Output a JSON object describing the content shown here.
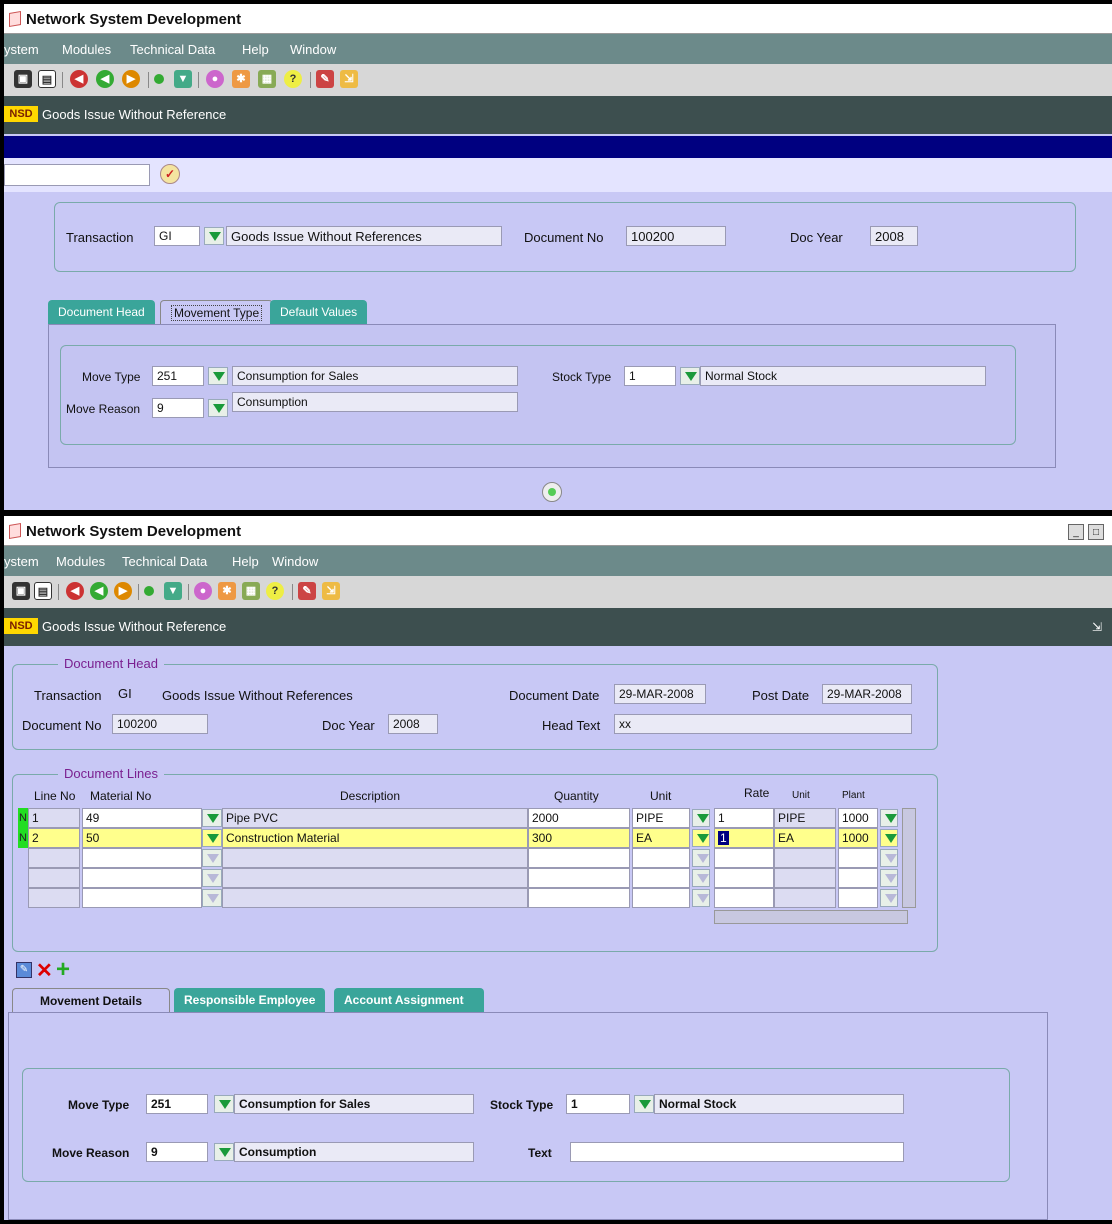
{
  "top": {
    "title": "Network System Development",
    "menu": [
      "ystem",
      "Modules",
      "Technical Data",
      "Help",
      "Window"
    ],
    "form_logo": "NSD",
    "form_title": "Goods Issue Without Reference",
    "transaction_label": "Transaction",
    "transaction_code": "GI",
    "transaction_desc": "Goods Issue Without References",
    "docno_label": "Document No",
    "docno": "100200",
    "docyear_label": "Doc Year",
    "docyear": "2008",
    "tabs": [
      "Document Head",
      "Movement Type",
      "Default Values"
    ],
    "move_type_label": "Move Type",
    "move_type": "251",
    "move_type_desc": "Consumption for Sales",
    "stock_type_label": "Stock Type",
    "stock_type": "1",
    "stock_type_desc": "Normal Stock",
    "move_reason_label": "Move Reason",
    "move_reason": "9",
    "move_reason_desc": "Consumption"
  },
  "bottom": {
    "title": "Network System Development",
    "menu": [
      "ystem",
      "Modules",
      "Technical Data",
      "Help",
      "Window"
    ],
    "form_logo": "NSD",
    "form_title": "Goods Issue Without Reference",
    "head_group": "Document Head",
    "transaction_label": "Transaction",
    "transaction_code": "GI",
    "transaction_desc": "Goods Issue Without References",
    "docdate_label": "Document Date",
    "docdate": "29-MAR-2008",
    "postdate_label": "Post Date",
    "postdate": "29-MAR-2008",
    "docno_label": "Document No",
    "docno": "100200",
    "docyear_label": "Doc Year",
    "docyear": "2008",
    "headtext_label": "Head Text",
    "headtext": "xx",
    "lines_group": "Document Lines",
    "columns": [
      "Line No",
      "Material No",
      "Description",
      "Quantity",
      "Unit",
      "Rate",
      "Unit",
      "Plant"
    ],
    "rows": [
      {
        "ind": "N",
        "line": "1",
        "material": "49",
        "desc": "Pipe PVC",
        "qty": "2000",
        "unit": "PIPE",
        "rate": "1",
        "unit2": "PIPE",
        "plant": "1000"
      },
      {
        "ind": "N",
        "line": "2",
        "material": "50",
        "desc": "Construction Material",
        "qty": "300",
        "unit": "EA",
        "rate": "1",
        "unit2": "EA",
        "plant": "1000"
      }
    ],
    "tabs": [
      "Movement Details",
      "Responsible Employee",
      "Account Assignment"
    ],
    "move_type_label": "Move Type",
    "move_type": "251",
    "move_type_desc": "Consumption for Sales",
    "stock_type_label": "Stock Type",
    "stock_type": "1",
    "stock_type_desc": "Normal Stock",
    "move_reason_label": "Move Reason",
    "move_reason": "9",
    "move_reason_desc": "Consumption",
    "text_label": "Text",
    "text_value": ""
  }
}
